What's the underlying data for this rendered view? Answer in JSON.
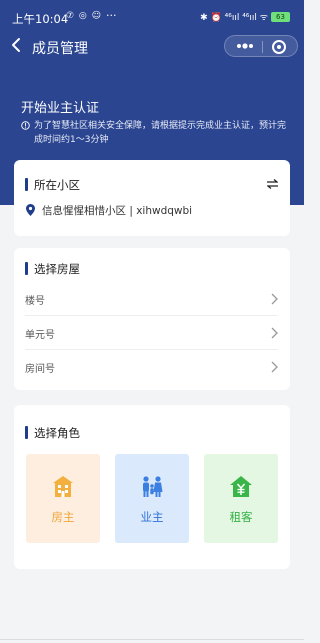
{
  "status_bar": {
    "time": "上午10:04",
    "app_icons": "⑦ ◎ ☺",
    "dots": "···",
    "icons": "✱ ⏰ ⁴⁶ııl ⁴⁶ııl ᯤ",
    "battery": "63"
  },
  "nav": {
    "title": "成员管理"
  },
  "hero": {
    "title": "开始业主认证",
    "desc": "为了智慧社区相关安全保障，请根据提示完成业主认证，预计完成时间约1～3分钟"
  },
  "community": {
    "section_title": "所在小区",
    "name": "信息惺惺相惜小区 | xihwdqwbi"
  },
  "house": {
    "section_title": "选择房屋",
    "rows": [
      {
        "label": "楼号"
      },
      {
        "label": "单元号"
      },
      {
        "label": "房间号"
      }
    ]
  },
  "roles": {
    "section_title": "选择角色",
    "items": [
      {
        "label": "房主",
        "icon": "building-icon",
        "color": "#f0a63a"
      },
      {
        "label": "业主",
        "icon": "family-icon",
        "color": "#2f73d8"
      },
      {
        "label": "租客",
        "icon": "house-yuan-icon",
        "color": "#34b046"
      }
    ]
  },
  "colors": {
    "hero_bg": "#2b4591",
    "page_bg": "#f3f4f6",
    "accent_bar": "#1f3d8a"
  }
}
